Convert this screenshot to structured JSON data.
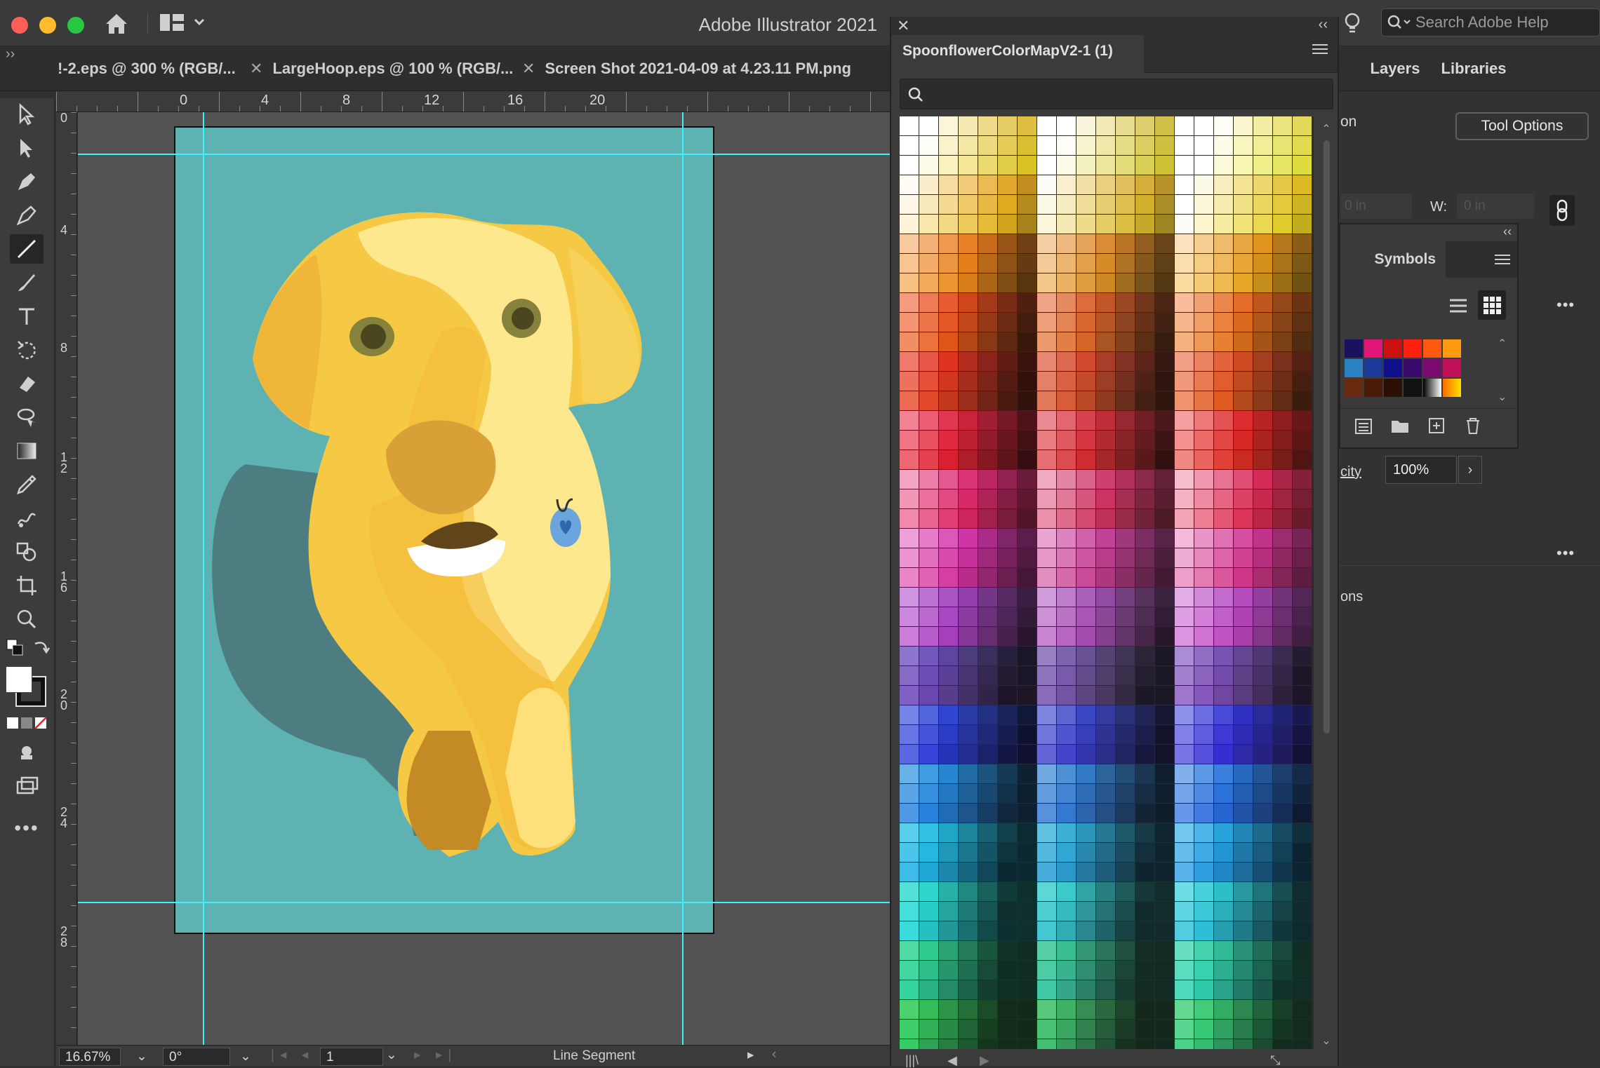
{
  "app": {
    "title": "Adobe Illustrator 2021",
    "search_placeholder": "Search Adobe Help"
  },
  "document_tabs": [
    {
      "label": "!-2.eps @ 300 % (RGB/..."
    },
    {
      "label": "LargeHoop.eps @ 100 % (RGB/..."
    },
    {
      "label": "Screen Shot 2021-04-09 at 4.23.11 PM.png"
    }
  ],
  "rulers": {
    "h": [
      "0",
      "4",
      "8",
      "12",
      "16",
      "20"
    ],
    "v": [
      "0",
      "4",
      "8",
      "1\n2",
      "1\n6",
      "2\n0",
      "2\n4",
      "2\n8"
    ]
  },
  "status": {
    "zoom": "16.67%",
    "rotation": "0°",
    "artboard": "1",
    "selection": "Line Segment"
  },
  "swatch_panel": {
    "title": "SpoonflowerColorMapV2-1 (1)"
  },
  "right_panel": {
    "tabs": [
      "Layers",
      "Libraries"
    ],
    "tool_options": "Tool Options",
    "w_label": "W:",
    "w_value": "0 in",
    "x_value": "0 in",
    "cut_label": "on",
    "opacity_label": "city",
    "opacity_value": "100%",
    "options_label": "ons"
  },
  "symbols_panel": {
    "title": "Symbols"
  },
  "colors": {
    "artboard": "#5eb2b2",
    "guide": "#3ff0ff",
    "dog": "#f6c945"
  }
}
